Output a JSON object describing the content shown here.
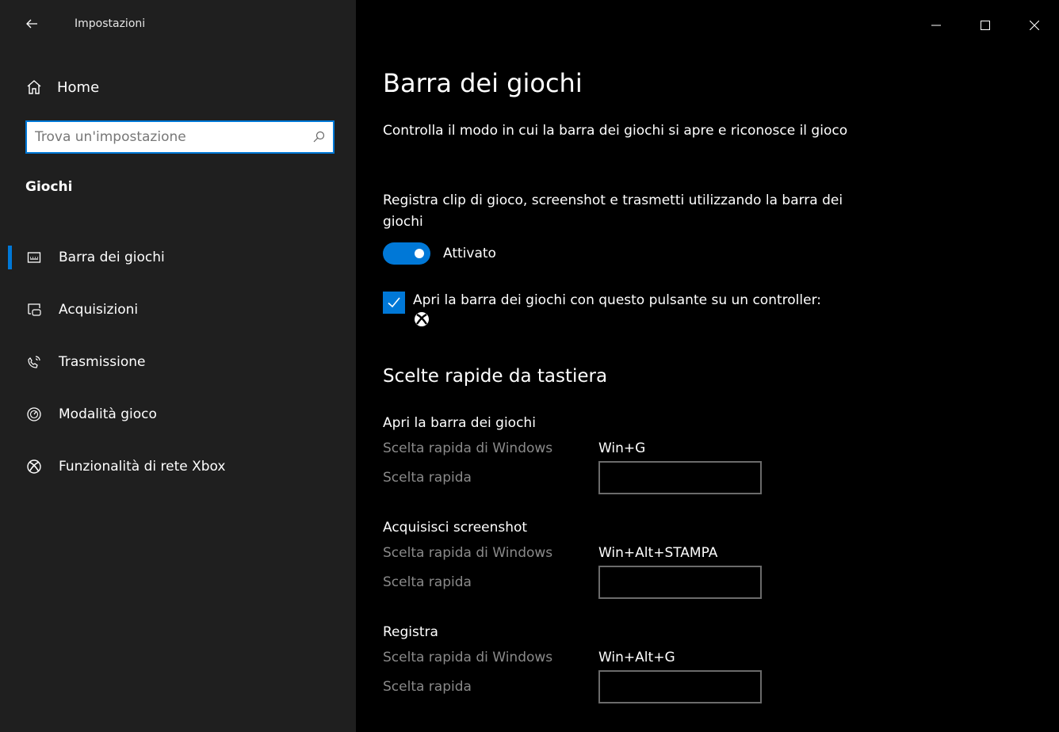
{
  "titlebar": {
    "title": "Impostazioni",
    "back_icon": "back-arrow-icon",
    "minimize_icon": "minimize-icon",
    "maximize_icon": "maximize-icon",
    "close_icon": "close-icon"
  },
  "sidebar": {
    "home_label": "Home",
    "search_placeholder": "Trova un'impostazione",
    "search_value": "",
    "section_heading": "Giochi",
    "items": [
      {
        "label": "Barra dei giochi",
        "icon": "game-bar-icon",
        "selected": true
      },
      {
        "label": "Acquisizioni",
        "icon": "captures-icon",
        "selected": false
      },
      {
        "label": "Trasmissione",
        "icon": "broadcast-icon",
        "selected": false
      },
      {
        "label": "Modalità gioco",
        "icon": "game-mode-icon",
        "selected": false
      },
      {
        "label": "Funzionalità di rete Xbox",
        "icon": "xbox-icon",
        "selected": false
      }
    ]
  },
  "main": {
    "title": "Barra dei giochi",
    "description": "Controlla il modo in cui la barra dei giochi si apre e riconosce il gioco",
    "toggle_description": "Registra clip di gioco, screenshot e trasmetti utilizzando la barra dei giochi",
    "toggle_state_label": "Attivato",
    "toggle_on": true,
    "checkbox_label": "Apri la barra dei giochi con questo pulsante su un controller:",
    "checkbox_checked": true,
    "shortcuts_heading": "Scelte rapide da tastiera",
    "shortcuts": [
      {
        "name": "Apri la barra dei giochi",
        "windows_key_label": "Scelta rapida di Windows",
        "windows_key_value": "Win+G",
        "custom_key_label": "Scelta rapida",
        "custom_key_value": ""
      },
      {
        "name": "Acquisisci screenshot",
        "windows_key_label": "Scelta rapida di Windows",
        "windows_key_value": "Win+Alt+STAMPA",
        "custom_key_label": "Scelta rapida",
        "custom_key_value": ""
      },
      {
        "name": "Registra",
        "windows_key_label": "Scelta rapida di Windows",
        "windows_key_value": "Win+Alt+G",
        "custom_key_label": "Scelta rapida",
        "custom_key_value": ""
      }
    ]
  },
  "colors": {
    "accent": "#0078d7",
    "sidebar_bg": "#1f1f1f",
    "main_bg": "#000000",
    "muted_text": "#8a8a8a"
  }
}
